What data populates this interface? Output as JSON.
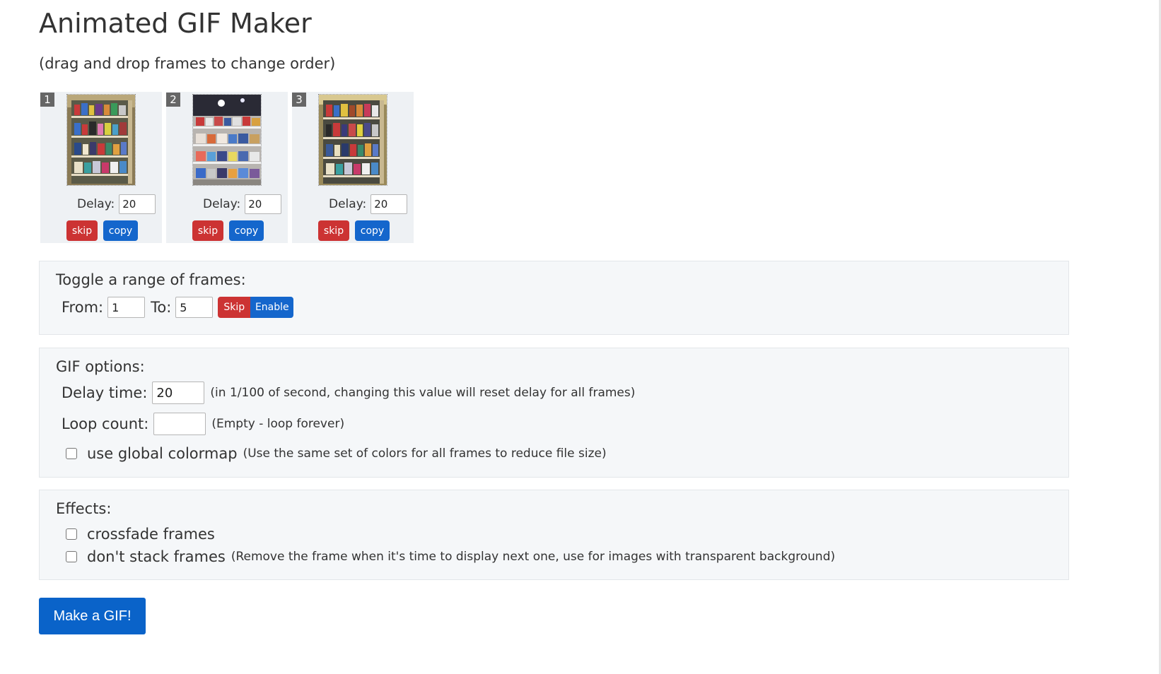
{
  "title": "Animated GIF Maker",
  "subtitle": "(drag and drop frames to change order)",
  "frames": [
    {
      "number": "1",
      "delay_label": "Delay:",
      "delay": "20",
      "skip_label": "skip",
      "copy_label": "copy",
      "thumb": "shelf-photo-1"
    },
    {
      "number": "2",
      "delay_label": "Delay:",
      "delay": "20",
      "skip_label": "skip",
      "copy_label": "copy",
      "thumb": "shelf-photo-2"
    },
    {
      "number": "3",
      "delay_label": "Delay:",
      "delay": "20",
      "skip_label": "skip",
      "copy_label": "copy",
      "thumb": "shelf-photo-3"
    }
  ],
  "toggle_range": {
    "title": "Toggle a range of frames:",
    "from_label": "From:",
    "from_value": "1",
    "to_label": "To:",
    "to_value": "5",
    "skip_label": "Skip",
    "enable_label": "Enable"
  },
  "gif_options": {
    "title": "GIF options:",
    "delay_label": "Delay time:",
    "delay_value": "20",
    "delay_note": "(in 1/100 of second, changing this value will reset delay for all frames)",
    "loop_label": "Loop count:",
    "loop_value": "",
    "loop_note": "(Empty - loop forever)",
    "colormap_label": "use global colormap",
    "colormap_note": "(Use the same set of colors for all frames to reduce file size)",
    "colormap_checked": false
  },
  "effects": {
    "title": "Effects:",
    "crossfade_label": "crossfade frames",
    "crossfade_checked": false,
    "nostack_label": "don't stack frames",
    "nostack_note": "(Remove the frame when it's time to display next one, use for images with transparent background)",
    "nostack_checked": false
  },
  "make_gif_label": "Make a GIF!",
  "colors": {
    "skip_red": "#cc3333",
    "copy_blue": "#1466cc",
    "primary_blue": "#0a63c9",
    "panel_bg": "#f5f7f9"
  }
}
